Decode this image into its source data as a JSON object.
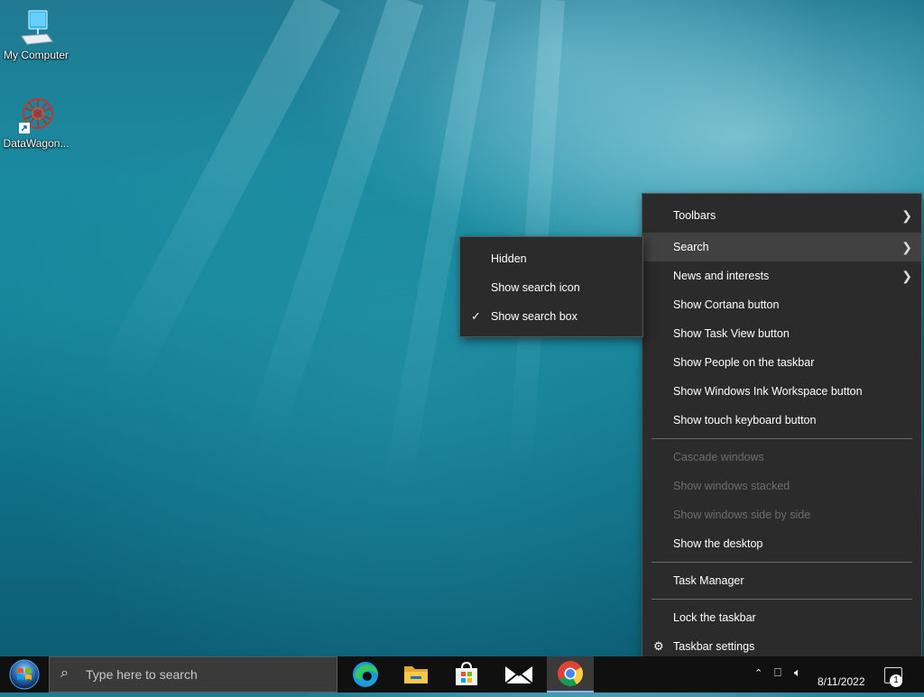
{
  "desktop": {
    "icons": [
      {
        "label": "My Computer",
        "icon": "computer-icon"
      },
      {
        "label": "DataWagon...",
        "icon": "datawagon-icon"
      }
    ]
  },
  "context_menu": {
    "items": [
      {
        "label": "Toolbars",
        "submenu": true
      },
      {
        "label": "Search",
        "submenu": true,
        "highlighted": true
      },
      {
        "label": "News and interests",
        "submenu": true
      },
      {
        "label": "Show Cortana button"
      },
      {
        "label": "Show Task View button"
      },
      {
        "label": "Show People on the taskbar"
      },
      {
        "label": "Show Windows Ink Workspace button"
      },
      {
        "label": "Show touch keyboard button"
      },
      {
        "label": "Cascade windows",
        "disabled": true
      },
      {
        "label": "Show windows stacked",
        "disabled": true
      },
      {
        "label": "Show windows side by side",
        "disabled": true
      },
      {
        "label": "Show the desktop"
      },
      {
        "label": "Task Manager"
      },
      {
        "label": "Lock the taskbar"
      },
      {
        "label": "Taskbar settings",
        "icon": "gear-icon"
      }
    ]
  },
  "search_submenu": {
    "items": [
      {
        "label": "Hidden",
        "checked": false
      },
      {
        "label": "Show search icon",
        "checked": false
      },
      {
        "label": "Show search box",
        "checked": true
      }
    ]
  },
  "taskbar": {
    "search_placeholder": "Type here to search",
    "apps": [
      "edge-icon",
      "file-explorer-icon",
      "store-icon",
      "mail-icon",
      "chrome-icon"
    ],
    "date": "8/11/2022",
    "notification_count": "1",
    "colors": {
      "background": "#101010",
      "active_accent": "#8ab4f8"
    }
  }
}
